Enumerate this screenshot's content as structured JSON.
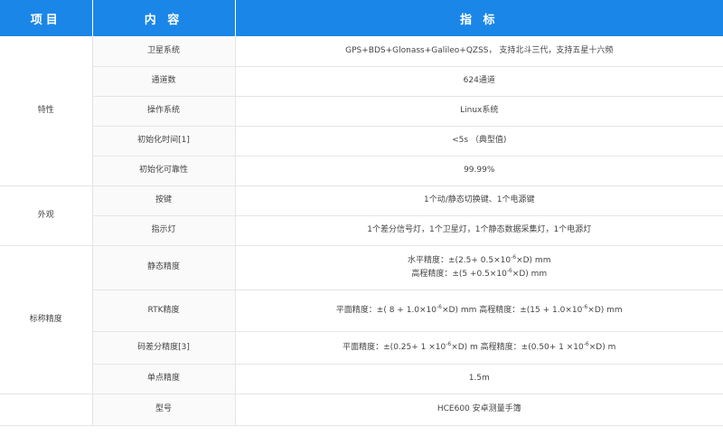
{
  "header": {
    "col1": "项目",
    "col2": "内 容",
    "col3": "指 标"
  },
  "groups": {
    "features": "特性",
    "appearance": "外观",
    "accuracy": "标称精度"
  },
  "rows": {
    "satellite": {
      "label": "卫星系统",
      "value": "GPS+BDS+Glonass+Galileo+QZSS， 支持北斗三代，支持五星十六频"
    },
    "channels": {
      "label": "通道数",
      "value": "624通道"
    },
    "os": {
      "label": "操作系统",
      "value": "Linux系统"
    },
    "init_time": {
      "label": "初始化时间[1]",
      "value": "<5s （典型值)"
    },
    "init_reliability": {
      "label": "初始化可靠性",
      "value": "99.99%"
    },
    "buttons": {
      "label": "按键",
      "value": "1个动/静态切换键、1个电源键"
    },
    "indicators": {
      "label": "指示灯",
      "value": "1个差分信号灯，1个卫星灯，1个静态数据采集灯，1个电源灯"
    },
    "static": {
      "label": "静态精度",
      "h_pre": "水平精度：±(2.5+ 0.5×10",
      "h_exp": "-6",
      "h_post": "×D) mm",
      "v_pre": "高程精度：±(5 +0.5×10",
      "v_exp": "-6",
      "v_post": "×D) mm"
    },
    "rtk": {
      "label": "RTK精度",
      "a_pre": "平面精度：±( 8 + 1.0×10",
      "a_exp": "-6",
      "a_mid": "×D) mm 高程精度：±(15 + 1.0×10",
      "b_exp": "-6",
      "b_post": "×D) mm"
    },
    "code_diff": {
      "label": "码差分精度[3]",
      "a_pre": "平面精度：±(0.25+ 1 ×10",
      "a_exp": "-6",
      "a_mid": "×D) m 高程精度：±(0.50+ 1 ×10",
      "b_exp": "-6",
      "b_post": "×D) m"
    },
    "single_point": {
      "label": "单点精度",
      "value": "1.5m"
    },
    "model": {
      "label": "型号",
      "value": "HCE600 安卓测量手簿"
    }
  }
}
